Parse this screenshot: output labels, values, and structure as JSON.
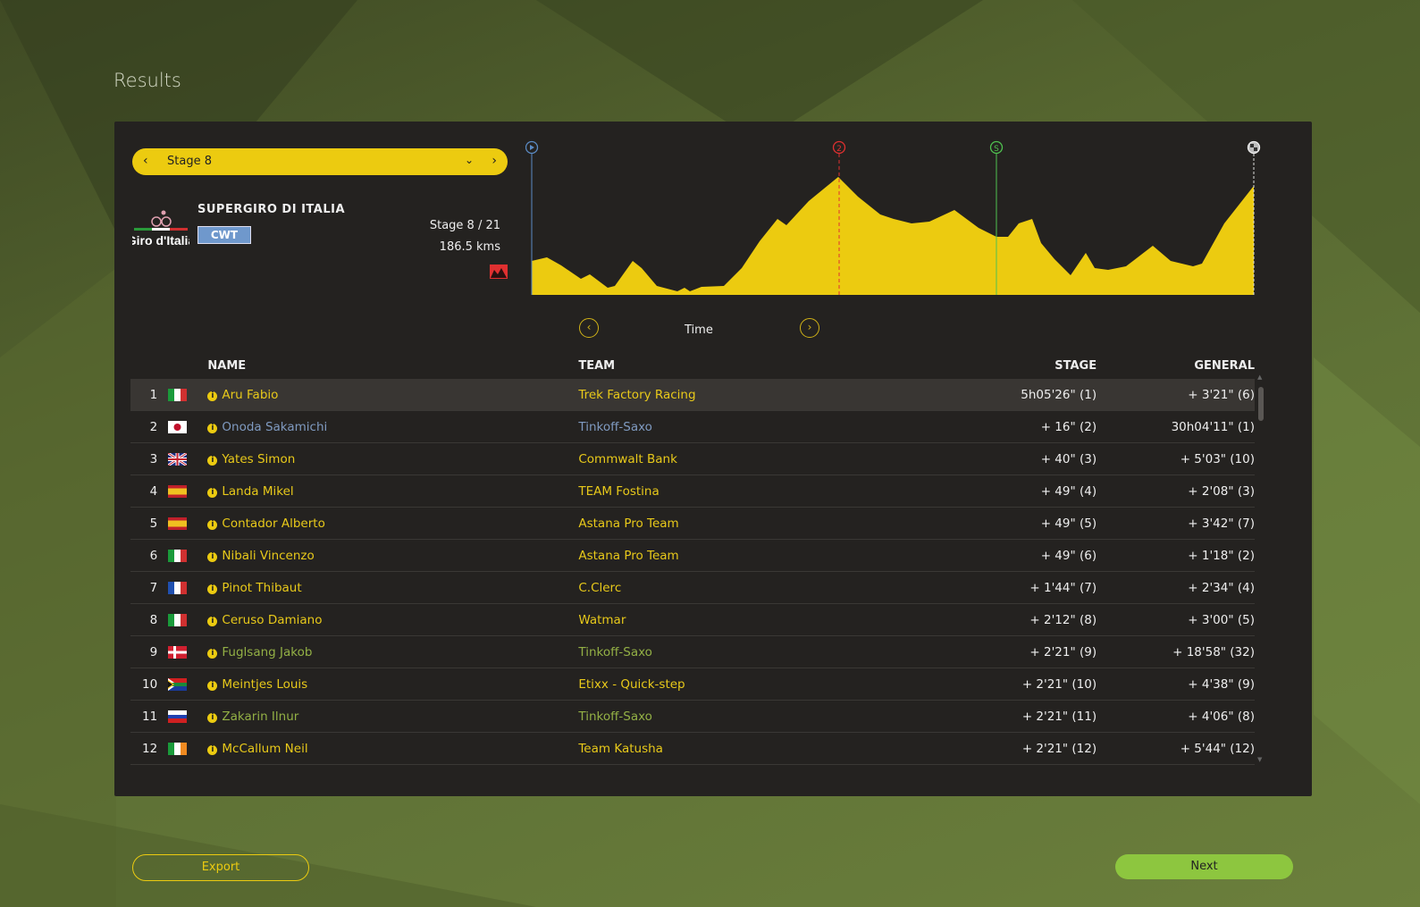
{
  "page_title": "Results",
  "stage_selector": {
    "label": "Stage 8"
  },
  "race": {
    "name": "SUPERGIRO DI ITALIA",
    "category": "CWT",
    "logo_text": "Giro d'Italia",
    "stage": "Stage 8 / 21",
    "distance": "186.5 kms"
  },
  "profile": {
    "markers": [
      {
        "type": "start",
        "color": "#5b8bc4"
      },
      {
        "label": "2",
        "type": "climb",
        "color": "#e03030"
      },
      {
        "label": "S",
        "type": "sprint",
        "color": "#4fc24f"
      },
      {
        "type": "finish",
        "color": "#dddddd"
      }
    ],
    "fill_color": "#eccb10"
  },
  "classification": {
    "label": "Time"
  },
  "table": {
    "headers": {
      "name": "NAME",
      "team": "TEAM",
      "stage": "STAGE",
      "general": "GENERAL"
    },
    "rows": [
      {
        "pos": "1",
        "flag": "it",
        "name": "Aru Fabio",
        "team": "Trek Factory Racing",
        "stage": "5h05'26\" (1)",
        "general": "+ 3'21\" (6)",
        "color": "yellow"
      },
      {
        "pos": "2",
        "flag": "jp",
        "name": "Onoda Sakamichi",
        "team": "Tinkoff-Saxo",
        "stage": "+ 16\" (2)",
        "general": "30h04'11\" (1)",
        "color": "blue"
      },
      {
        "pos": "3",
        "flag": "gb",
        "name": "Yates Simon",
        "team": "Commwalt Bank",
        "stage": "+ 40\" (3)",
        "general": "+ 5'03\" (10)",
        "color": "yellow"
      },
      {
        "pos": "4",
        "flag": "es",
        "name": "Landa Mikel",
        "team": "TEAM Fostina",
        "stage": "+ 49\" (4)",
        "general": "+ 2'08\" (3)",
        "color": "yellow"
      },
      {
        "pos": "5",
        "flag": "es",
        "name": "Contador Alberto",
        "team": "Astana Pro Team",
        "stage": "+ 49\" (5)",
        "general": "+ 3'42\" (7)",
        "color": "yellow"
      },
      {
        "pos": "6",
        "flag": "it",
        "name": "Nibali Vincenzo",
        "team": "Astana Pro Team",
        "stage": "+ 49\" (6)",
        "general": "+ 1'18\" (2)",
        "color": "yellow"
      },
      {
        "pos": "7",
        "flag": "fr",
        "name": "Pinot Thibaut",
        "team": "C.Clerc",
        "stage": "+ 1'44\" (7)",
        "general": "+ 2'34\" (4)",
        "color": "yellow"
      },
      {
        "pos": "8",
        "flag": "it",
        "name": "Ceruso Damiano",
        "team": "Watmar",
        "stage": "+ 2'12\" (8)",
        "general": "+ 3'00\" (5)",
        "color": "yellow"
      },
      {
        "pos": "9",
        "flag": "dk",
        "name": "Fuglsang Jakob",
        "team": "Tinkoff-Saxo",
        "stage": "+ 2'21\" (9)",
        "general": "+ 18'58\" (32)",
        "color": "green"
      },
      {
        "pos": "10",
        "flag": "za",
        "name": "Meintjes Louis",
        "team": "Etixx - Quick-step",
        "stage": "+ 2'21\" (10)",
        "general": "+ 4'38\" (9)",
        "color": "yellow"
      },
      {
        "pos": "11",
        "flag": "ru",
        "name": "Zakarin Ilnur",
        "team": "Tinkoff-Saxo",
        "stage": "+ 2'21\" (11)",
        "general": "+ 4'06\" (8)",
        "color": "green"
      },
      {
        "pos": "12",
        "flag": "ie",
        "name": "McCallum Neil",
        "team": "Team Katusha",
        "stage": "+ 2'21\" (12)",
        "general": "+ 5'44\" (12)",
        "color": "yellow"
      }
    ]
  },
  "buttons": {
    "export": "Export",
    "next": "Next"
  }
}
